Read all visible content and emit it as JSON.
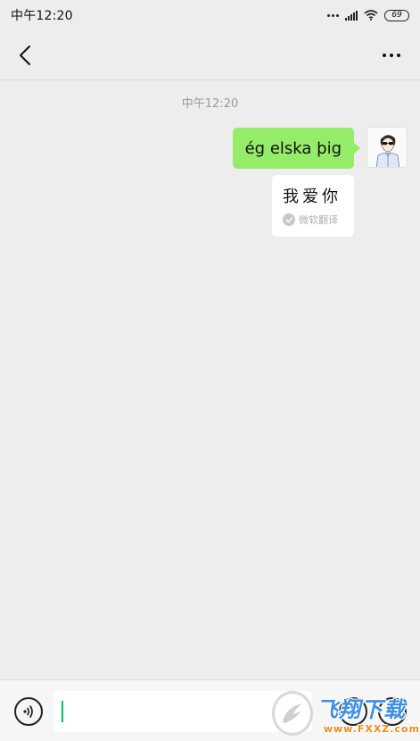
{
  "status_bar": {
    "time": "中午12:20",
    "battery": "69"
  },
  "nav": {
    "back_icon": "chevron-left-icon",
    "more_icon": "more-horizontal-icon"
  },
  "chat": {
    "timestamp": "中午12:20",
    "messages": [
      {
        "sender": "self",
        "text": "ég elska þig",
        "translation": {
          "text": "我爱你",
          "source": "微软翻译"
        }
      }
    ]
  },
  "input_bar": {
    "voice_icon": "voice-icon",
    "text": "",
    "emoji_icon": "emoji-icon",
    "add_icon": "add-icon"
  },
  "watermark": {
    "title": "飞翔下载",
    "url": "www.FXXZ.com"
  },
  "colors": {
    "background": "#ededed",
    "sent_bubble": "#95ec69",
    "cursor": "#07c160",
    "watermark_blue": "#3f8fe0",
    "watermark_orange": "#f08a1c"
  }
}
